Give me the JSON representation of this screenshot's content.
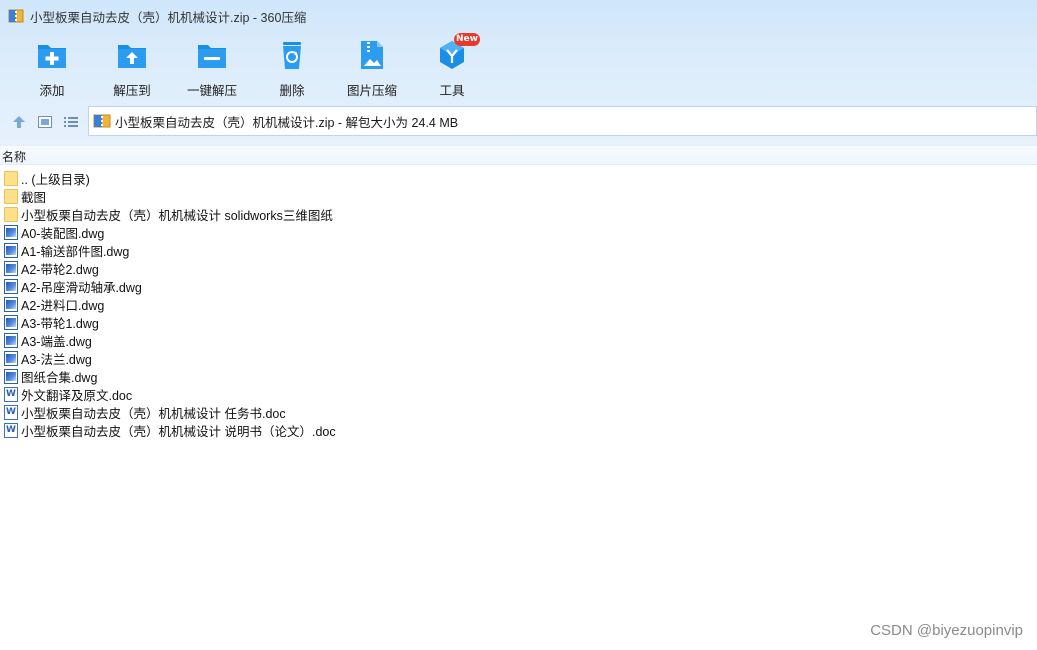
{
  "window": {
    "title": "小型板栗自动去皮（壳）机机械设计.zip - 360压缩"
  },
  "toolbar": {
    "items": [
      {
        "label": "添加",
        "icon": "add-folder-icon"
      },
      {
        "label": "解压到",
        "icon": "extract-to-icon"
      },
      {
        "label": "一键解压",
        "icon": "one-click-extract-icon"
      },
      {
        "label": "删除",
        "icon": "recycle-bin-icon"
      },
      {
        "label": "图片压缩",
        "icon": "image-compress-icon"
      },
      {
        "label": "工具",
        "icon": "tools-icon"
      }
    ],
    "new_badge": "New"
  },
  "address": {
    "path": "小型板栗自动去皮（壳）机机械设计.zip - 解包大小为 24.4 MB"
  },
  "list": {
    "header_name": "名称",
    "files": [
      {
        "name": ".. (上级目录)",
        "type": "folder"
      },
      {
        "name": "截图",
        "type": "folder"
      },
      {
        "name": "小型板栗自动去皮（壳）机机械设计 solidworks三维图纸",
        "type": "folder"
      },
      {
        "name": "A0-装配图.dwg",
        "type": "dwg"
      },
      {
        "name": "A1-输送部件图.dwg",
        "type": "dwg"
      },
      {
        "name": "A2-带轮2.dwg",
        "type": "dwg"
      },
      {
        "name": "A2-吊座滑动轴承.dwg",
        "type": "dwg"
      },
      {
        "name": "A2-进料口.dwg",
        "type": "dwg"
      },
      {
        "name": "A3-带轮1.dwg",
        "type": "dwg"
      },
      {
        "name": "A3-端盖.dwg",
        "type": "dwg"
      },
      {
        "name": "A3-法兰.dwg",
        "type": "dwg"
      },
      {
        "name": "图纸合集.dwg",
        "type": "dwg"
      },
      {
        "name": "外文翻译及原文.doc",
        "type": "doc"
      },
      {
        "name": "小型板栗自动去皮（壳）机机械设计 任务书.doc",
        "type": "doc"
      },
      {
        "name": "小型板栗自动去皮（壳）机机械设计 说明书（论文）.doc",
        "type": "doc"
      }
    ]
  },
  "watermark": "CSDN @biyezuopinvip",
  "colors": {
    "accent": "#1a8fe6",
    "chrome_top": "#cfe6fb",
    "folder": "#fde08a",
    "badge": "#e8392b"
  }
}
